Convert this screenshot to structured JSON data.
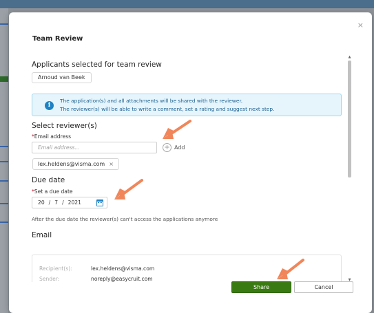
{
  "modal": {
    "title": "Team Review",
    "close_icon": "close-icon"
  },
  "applicants": {
    "heading": "Applicants selected for team review",
    "chip": "Arnoud van Beek"
  },
  "info": {
    "line1": "The application(s) and all attachments will be shared with the reviewer.",
    "line2": "The reviewer(s) will be able to write a comment, set a rating and suggest next step."
  },
  "reviewers": {
    "heading": "Select reviewer(s)",
    "email_label": "Email address",
    "email_placeholder": "Email address...",
    "add_label": "Add",
    "tag": "lex.heldens@visma.com"
  },
  "due_date": {
    "heading": "Due date",
    "label": "Set a due date",
    "day": "20",
    "month": "7",
    "year": "2021",
    "sep": "/",
    "note": "After the due date the reviewer(s) can't access the applications anymore"
  },
  "email": {
    "heading": "Email",
    "recipient_label": "Recipient(s):",
    "recipient_value": "lex.heldens@visma.com",
    "sender_label": "Sender:",
    "sender_value": "noreply@easycruit.com"
  },
  "footer": {
    "share": "Share",
    "cancel": "Cancel"
  },
  "colors": {
    "accent_green": "#3a7a12",
    "info_blue": "#1d82c4",
    "annotation_arrow": "#f0865a"
  }
}
